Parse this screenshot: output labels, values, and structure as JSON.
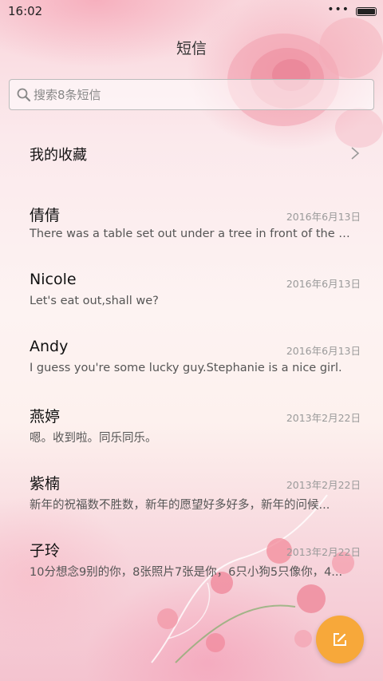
{
  "status_bar": {
    "time": "16:02",
    "dots": "•••"
  },
  "header": {
    "title": "短信"
  },
  "search": {
    "placeholder": "搜索8条短信"
  },
  "favorites": {
    "label": "我的收藏"
  },
  "threads": [
    {
      "name": "倩倩",
      "date": "2016年6月13日",
      "preview": "There was a table set out under a tree in front of the h..."
    },
    {
      "name": "Nicole",
      "date": "2016年6月13日",
      "preview": "Let's eat out,shall we?"
    },
    {
      "name": "Andy",
      "date": "2016年6月13日",
      "preview": "I guess you're some lucky guy.Stephanie is a nice girl."
    },
    {
      "name": "燕婷",
      "date": "2013年2月22日",
      "preview": "嗯。收到啦。同乐同乐。"
    },
    {
      "name": "紫楠",
      "date": "2013年2月22日",
      "preview": "新年的祝福数不胜数，新年的愿望好多好多，新年的问候..."
    },
    {
      "name": "子玲",
      "date": "2013年2月22日",
      "preview": "10分想念9别的你，8张照片7张是你，6只小狗5只像你，4..."
    }
  ],
  "colors": {
    "fab": "#f7a83a",
    "background_pink": "#f9d6dc"
  },
  "icons": {
    "search": "search-icon",
    "chevron": "chevron-right-icon",
    "compose": "compose-icon",
    "battery": "battery-icon"
  }
}
